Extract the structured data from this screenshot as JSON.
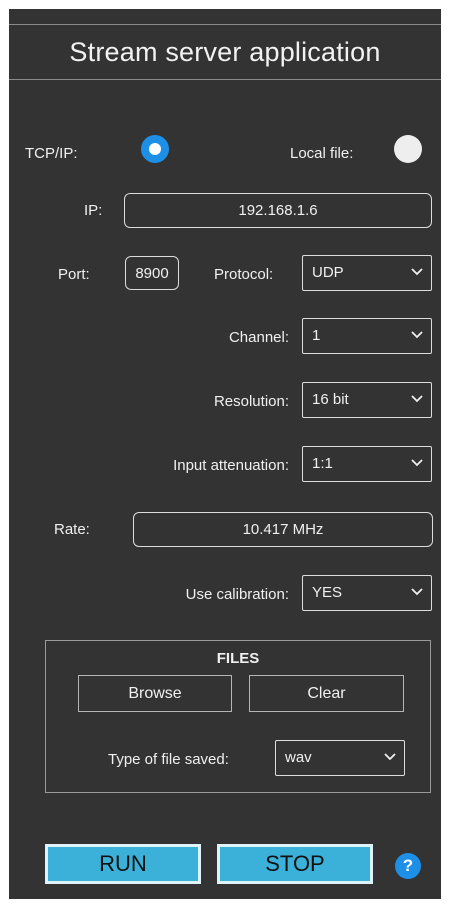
{
  "app": {
    "title": "Stream server application"
  },
  "source": {
    "tcp_label": "TCP/IP:",
    "tcp_selected": true,
    "local_label": "Local file:",
    "local_selected": false
  },
  "network": {
    "ip_label": "IP:",
    "ip_value": "192.168.1.6",
    "port_label": "Port:",
    "port_value": "8900",
    "protocol_label": "Protocol:",
    "protocol_value": "UDP"
  },
  "settings": {
    "channel_label": "Channel:",
    "channel_value": "1",
    "resolution_label": "Resolution:",
    "resolution_value": "16 bit",
    "attenuation_label": "Input attenuation:",
    "attenuation_value": "1:1",
    "rate_label": "Rate:",
    "rate_value": "10.417 MHz",
    "calibration_label": "Use calibration:",
    "calibration_value": "YES"
  },
  "files": {
    "title": "FILES",
    "browse_label": "Browse",
    "clear_label": "Clear",
    "type_label": "Type of file saved:",
    "type_value": "wav"
  },
  "actions": {
    "run_label": "RUN",
    "stop_label": "STOP",
    "help_label": "?"
  },
  "colors": {
    "background": "#333333",
    "accent": "#1e8fe6",
    "button": "#3bb0d8"
  },
  "icons": {
    "dropdown": "chevron-down-icon",
    "help": "help-icon"
  }
}
